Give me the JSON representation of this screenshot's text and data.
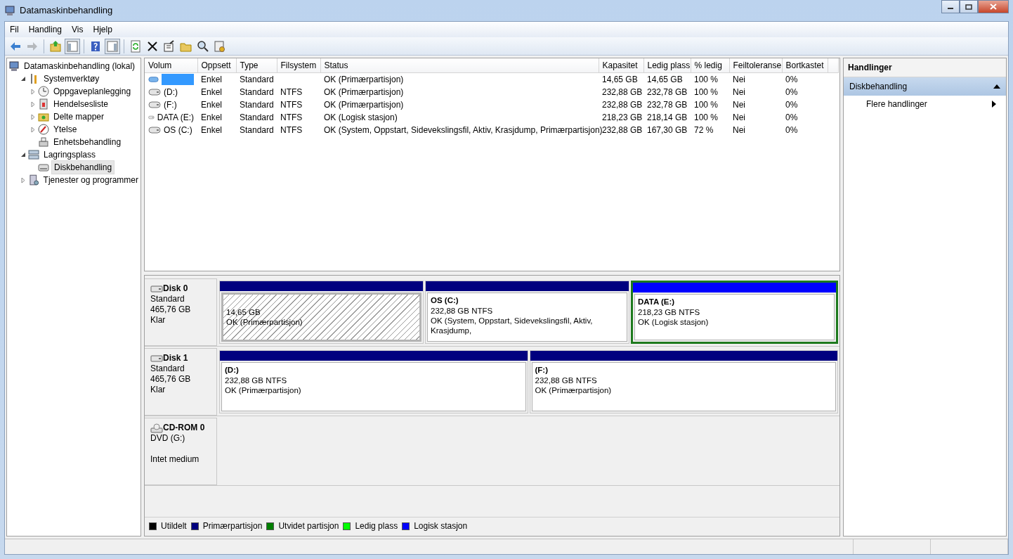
{
  "window": {
    "title": "Datamaskinbehandling"
  },
  "menu": [
    {
      "label": "Fil"
    },
    {
      "label": "Handling"
    },
    {
      "label": "Vis"
    },
    {
      "label": "Hjelp"
    }
  ],
  "toolbar": [
    {
      "kind": "back",
      "disabled": false,
      "pressed": false
    },
    {
      "kind": "forward",
      "disabled": true,
      "pressed": false
    },
    {
      "kind": "separator"
    },
    {
      "kind": "up",
      "disabled": false,
      "pressed": false
    },
    {
      "kind": "tree",
      "disabled": false,
      "pressed": true
    },
    {
      "kind": "separator"
    },
    {
      "kind": "help",
      "disabled": false,
      "pressed": false
    },
    {
      "kind": "pane",
      "disabled": false,
      "pressed": true
    },
    {
      "kind": "separator"
    },
    {
      "kind": "refresh",
      "disabled": false,
      "pressed": false
    },
    {
      "kind": "delete",
      "disabled": false,
      "pressed": false
    },
    {
      "kind": "properties",
      "disabled": false,
      "pressed": false
    },
    {
      "kind": "open",
      "disabled": false,
      "pressed": false
    },
    {
      "kind": "search",
      "disabled": false,
      "pressed": false
    },
    {
      "kind": "settings",
      "disabled": false,
      "pressed": false
    }
  ],
  "tree": [
    {
      "label": "Datamaskinbehandling (lokal)",
      "selected": false,
      "children": [
        {
          "label": "Systemverktøy",
          "expanded": true,
          "selected": false,
          "children": [
            {
              "label": "Oppgaveplanlegging",
              "expanded": false,
              "selected": false
            },
            {
              "label": "Hendelsesliste",
              "expanded": false,
              "selected": false
            },
            {
              "label": "Delte mapper",
              "expanded": false,
              "selected": false
            },
            {
              "label": "Ytelse",
              "expanded": false,
              "selected": false
            },
            {
              "label": "Enhetsbehandling",
              "selected": false
            }
          ]
        },
        {
          "label": "Lagringsplass",
          "expanded": true,
          "selected": false,
          "children": [
            {
              "label": "Diskbehandling",
              "selected": true
            }
          ]
        },
        {
          "label": "Tjenester og programmer",
          "expanded": false,
          "selected": false
        }
      ]
    }
  ],
  "table": {
    "columns": [
      "Volum",
      "Oppsett",
      "Type",
      "Filsystem",
      "Status",
      "Kapasitet",
      "Ledig plass",
      "% ledig",
      "Feiltoleranse",
      "Bortkastet"
    ],
    "rows": [
      {
        "selected": true,
        "cells": [
          "",
          "Enkel",
          "Standard",
          "",
          "OK (Primærpartisjon)",
          "14,65 GB",
          "14,65 GB",
          "100 %",
          "Nei",
          "0%"
        ]
      },
      {
        "selected": false,
        "cells": [
          "(D:)",
          "Enkel",
          "Standard",
          "NTFS",
          "OK (Primærpartisjon)",
          "232,88 GB",
          "232,78 GB",
          "100 %",
          "Nei",
          "0%"
        ]
      },
      {
        "selected": false,
        "cells": [
          "(F:)",
          "Enkel",
          "Standard",
          "NTFS",
          "OK (Primærpartisjon)",
          "232,88 GB",
          "232,78 GB",
          "100 %",
          "Nei",
          "0%"
        ]
      },
      {
        "selected": false,
        "cells": [
          "DATA (E:)",
          "Enkel",
          "Standard",
          "NTFS",
          "OK (Logisk stasjon)",
          "218,23 GB",
          "218,14 GB",
          "100 %",
          "Nei",
          "0%"
        ]
      },
      {
        "selected": false,
        "cells": [
          "OS (C:)",
          "Enkel",
          "Standard",
          "NTFS",
          "OK (System, Oppstart, Sidevekslingsfil, Aktiv, Krasjdump, Primærpartisjon)",
          "232,88 GB",
          "167,30 GB",
          "72 %",
          "Nei",
          "0%"
        ]
      }
    ]
  },
  "disks": [
    {
      "kind": "disk",
      "name": "Disk 0",
      "type": "Standard",
      "size": "465,76 GB",
      "status": "Klar",
      "partitions": [
        {
          "size": "14,65 GB",
          "status": "OK (Primærpartisjon)",
          "color": "#00007f",
          "selected": true,
          "extended": false
        },
        {
          "name": "OS  (C:)",
          "size": "232,88 GB NTFS",
          "status": "OK (System, Oppstart, Sidevekslingsfil, Aktiv, Krasjdump,",
          "color": "#00007f",
          "selected": false,
          "extended": false
        },
        {
          "name": "DATA  (E:)",
          "size": "218,23 GB NTFS",
          "status": "OK (Logisk stasjon)",
          "color": "#0000ff",
          "selected": false,
          "extended": true
        }
      ]
    },
    {
      "kind": "disk",
      "name": "Disk 1",
      "type": "Standard",
      "size": "465,76 GB",
      "status": "Klar",
      "partitions": [
        {
          "name": "(D:)",
          "size": "232,88 GB NTFS",
          "status": "OK (Primærpartisjon)",
          "color": "#00007f",
          "selected": false,
          "extended": false
        },
        {
          "name": "(F:)",
          "size": "232,88 GB NTFS",
          "status": "OK (Primærpartisjon)",
          "color": "#00007f",
          "selected": false,
          "extended": false
        }
      ]
    },
    {
      "kind": "cdrom",
      "name": "CD-ROM 0",
      "type": "DVD (G:)",
      "status": "Intet medium"
    }
  ],
  "legend": [
    {
      "label": "Utildelt",
      "color": "#000000"
    },
    {
      "label": "Primærpartisjon",
      "color": "#00007f"
    },
    {
      "label": "Utvidet partisjon",
      "color": "#007f00"
    },
    {
      "label": "Ledig plass",
      "color": "#00ff00"
    },
    {
      "label": "Logisk stasjon",
      "color": "#0000ff"
    }
  ],
  "actions": {
    "title": "Handlinger",
    "sections": [
      {
        "label": "Diskbehandling",
        "expanded": true,
        "items": [
          {
            "label": "Flere handlinger"
          }
        ]
      }
    ]
  }
}
